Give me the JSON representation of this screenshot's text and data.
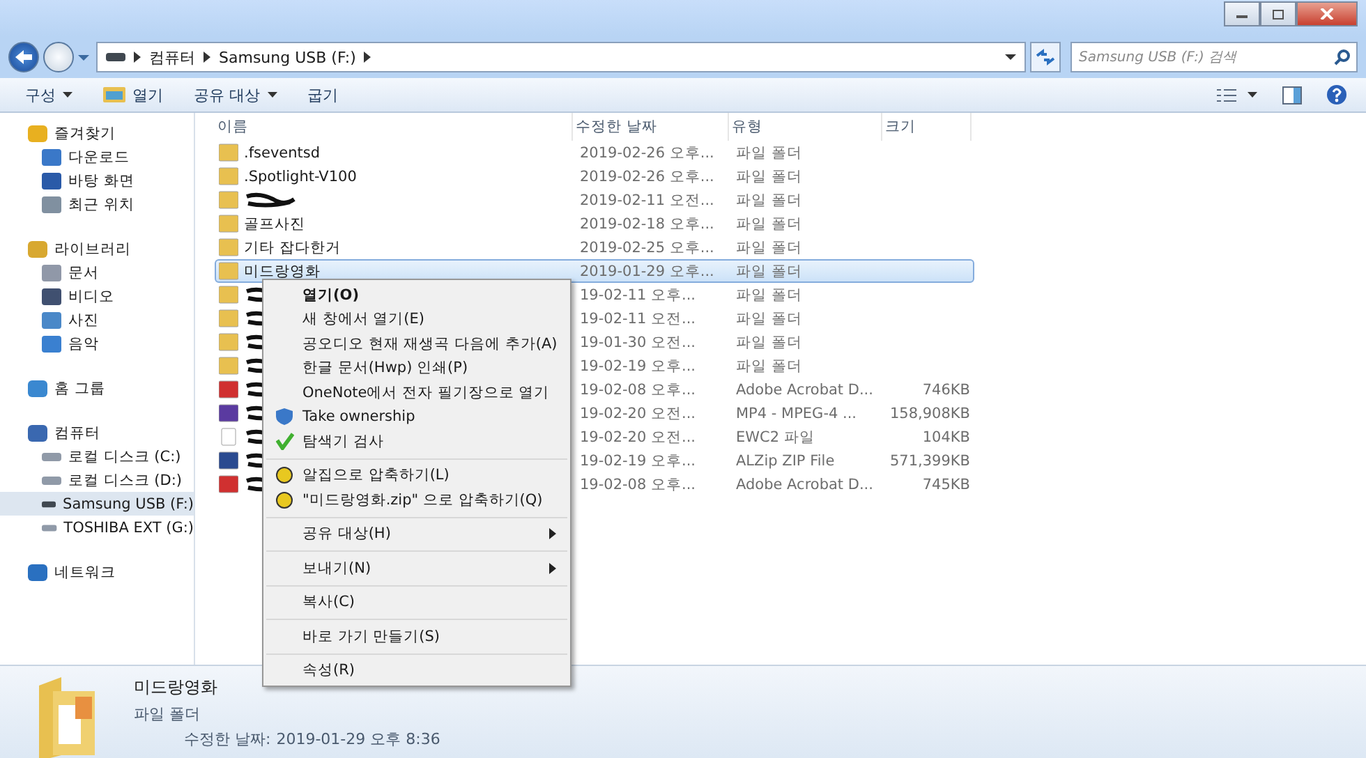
{
  "address_bar": {
    "crumbs": [
      "컴퓨터",
      "Samsung USB (F:)"
    ]
  },
  "search": {
    "placeholder": "Samsung USB (F:) 검색"
  },
  "toolbar": {
    "items": [
      {
        "label": "구성",
        "dropdown": true,
        "icon": false
      },
      {
        "label": "열기",
        "dropdown": false,
        "icon": true
      },
      {
        "label": "공유 대상",
        "dropdown": true,
        "icon": false
      },
      {
        "label": "굽기",
        "dropdown": false,
        "icon": false
      }
    ]
  },
  "sidebar": {
    "groups": [
      {
        "label": "즐겨찾기",
        "kind": "star",
        "children": [
          {
            "label": "다운로드",
            "kind": "download",
            "selected": false
          },
          {
            "label": "바탕 화면",
            "kind": "desktop",
            "selected": false
          },
          {
            "label": "최근 위치",
            "kind": "recent",
            "selected": false
          }
        ]
      },
      {
        "label": "라이브러리",
        "kind": "library",
        "children": [
          {
            "label": "문서",
            "kind": "doc",
            "selected": false
          },
          {
            "label": "비디오",
            "kind": "video",
            "selected": false
          },
          {
            "label": "사진",
            "kind": "photo",
            "selected": false
          },
          {
            "label": "음악",
            "kind": "music",
            "selected": false
          }
        ]
      },
      {
        "label": "홈 그룹",
        "kind": "homegroup"
      },
      {
        "label": "컴퓨터",
        "kind": "computer",
        "children": [
          {
            "label": "로컬 디스크 (C:)",
            "kind": "drive",
            "selected": false
          },
          {
            "label": "로컬 디스크 (D:)",
            "kind": "drive",
            "selected": false
          },
          {
            "label": "Samsung USB (F:)",
            "kind": "usb",
            "selected": true
          },
          {
            "label": "TOSHIBA EXT (G:)",
            "kind": "drive",
            "selected": false
          }
        ]
      },
      {
        "label": "네트워크",
        "kind": "network"
      }
    ]
  },
  "table": {
    "columns": [
      "이름",
      "수정한 날짜",
      "유형",
      "크기"
    ],
    "rows": [
      {
        "kind": "folder",
        "name": ".fseventsd",
        "redacted": false,
        "date": "2019-02-26 오후...",
        "type": "파일 폴더",
        "selected": false
      },
      {
        "kind": "folder",
        "name": ".Spotlight-V100",
        "redacted": false,
        "date": "2019-02-26 오후...",
        "type": "파일 폴더",
        "selected": false
      },
      {
        "kind": "folder",
        "redacted": true,
        "date": "2019-02-11 오전...",
        "type": "파일 폴더",
        "selected": false
      },
      {
        "kind": "folder",
        "name": "골프사진",
        "redacted": false,
        "date": "2019-02-18 오후...",
        "type": "파일 폴더",
        "selected": false
      },
      {
        "kind": "folder",
        "name": "기타 잡다한거",
        "redacted": false,
        "date": "2019-02-25 오후...",
        "type": "파일 폴더",
        "selected": false
      },
      {
        "kind": "folder",
        "name": "미드랑영화",
        "redacted": false,
        "date": "2019-01-29 오후...",
        "type": "파일 폴더",
        "selected": true
      },
      {
        "kind": "folder",
        "redacted": true,
        "date": "19-02-11 오후...",
        "type": "파일 폴더",
        "selected": false
      },
      {
        "kind": "folder",
        "redacted": true,
        "date": "19-02-11 오전...",
        "type": "파일 폴더",
        "selected": false
      },
      {
        "kind": "folder",
        "redacted": true,
        "date": "19-01-30 오전...",
        "type": "파일 폴더",
        "selected": false
      },
      {
        "kind": "folder",
        "redacted": true,
        "date": "19-02-19 오후...",
        "type": "파일 폴더",
        "selected": false
      },
      {
        "kind": "pdf",
        "redacted": true,
        "date": "19-02-08 오후...",
        "type": "Adobe Acrobat D...",
        "size": "746KB",
        "selected": false
      },
      {
        "kind": "video",
        "redacted": true,
        "date": "19-02-20 오전...",
        "type": "MP4 - MPEG-4 ...",
        "size": "158,908KB",
        "selected": false
      },
      {
        "kind": "file",
        "redacted": true,
        "date": "19-02-20 오전...",
        "type": "EWC2 파일",
        "size": "104KB",
        "selected": false
      },
      {
        "kind": "zip",
        "redacted": true,
        "date": "19-02-19 오후...",
        "type": "ALZip ZIP File",
        "size": "571,399KB",
        "selected": false
      },
      {
        "kind": "pdf",
        "redacted": true,
        "date": "19-02-08 오후...",
        "type": "Adobe Acrobat D...",
        "size": "745KB",
        "selected": false
      }
    ]
  },
  "context_menu": {
    "items": [
      {
        "label": "열기(O)",
        "kind": "text",
        "bold": true,
        "separator_before": false,
        "submenu": false
      },
      {
        "label": "새 창에서 열기(E)",
        "kind": "text",
        "bold": false,
        "separator_before": false,
        "submenu": false
      },
      {
        "label": "공오디오 현재 재생곡 다음에 추가(A)",
        "kind": "text",
        "bold": false,
        "separator_before": false,
        "submenu": false
      },
      {
        "label": "한글 문서(Hwp) 인쇄(P)",
        "kind": "text",
        "bold": false,
        "separator_before": false,
        "submenu": false
      },
      {
        "label": "OneNote에서 전자 필기장으로 열기",
        "kind": "text",
        "bold": false,
        "separator_before": false,
        "submenu": false
      },
      {
        "label": "Take ownership",
        "kind": "shield",
        "bold": false,
        "separator_before": false,
        "submenu": false
      },
      {
        "label": "탐색기 검사",
        "kind": "check",
        "bold": false,
        "separator_before": false,
        "submenu": false
      },
      {
        "label": "알집으로 압축하기(L)",
        "kind": "alzip",
        "bold": false,
        "separator_before": true,
        "submenu": false
      },
      {
        "label": "\"미드랑영화.zip\" 으로 압축하기(Q)",
        "kind": "alzip",
        "bold": false,
        "separator_before": false,
        "submenu": false
      },
      {
        "label": "공유 대상(H)",
        "kind": "text",
        "bold": false,
        "separator_before": true,
        "submenu": true
      },
      {
        "label": "보내기(N)",
        "kind": "text",
        "bold": false,
        "separator_before": true,
        "submenu": true
      },
      {
        "label": "복사(C)",
        "kind": "text",
        "bold": false,
        "separator_before": true,
        "submenu": false
      },
      {
        "label": "바로 가기 만들기(S)",
        "kind": "text",
        "bold": false,
        "separator_before": true,
        "submenu": false
      },
      {
        "label": "속성(R)",
        "kind": "text",
        "bold": false,
        "separator_before": true,
        "submenu": false
      }
    ]
  },
  "details": {
    "name": "미드랑영화",
    "type": "파일 폴더",
    "date_label": "수정한 날짜:",
    "date": "2019-01-29 오후 8:36"
  }
}
